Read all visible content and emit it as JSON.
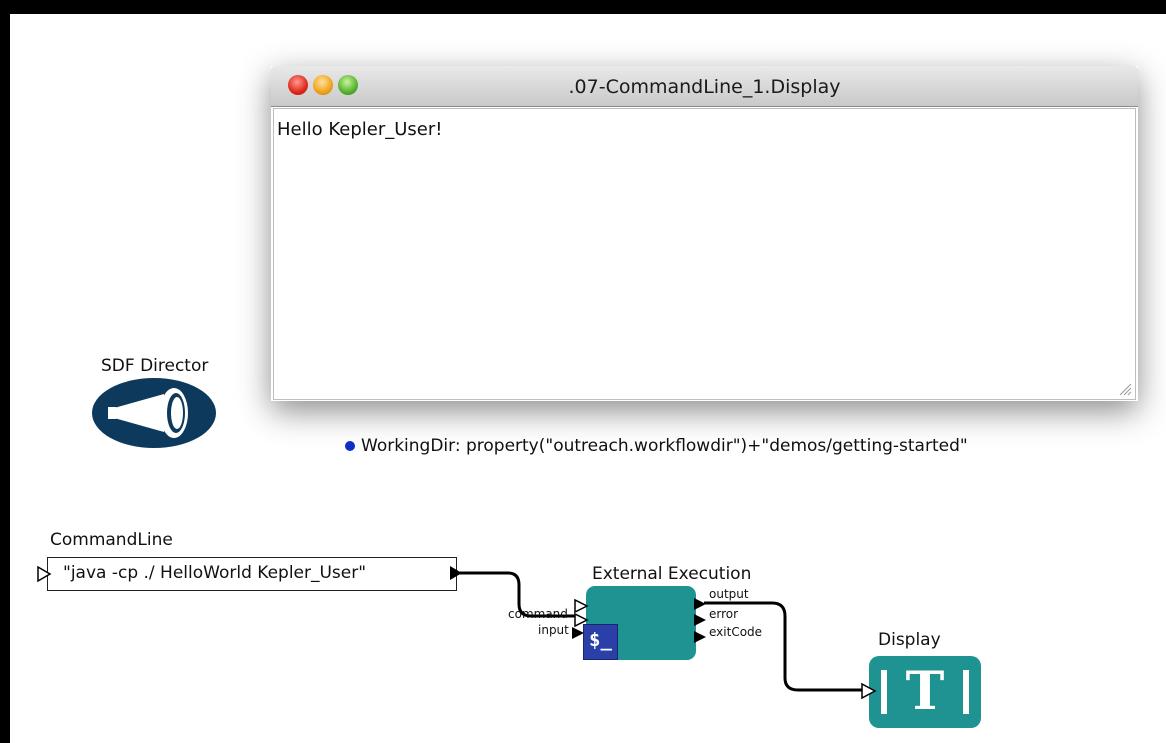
{
  "display_window": {
    "title": ".07-CommandLine_1.Display",
    "content_text": "Hello Kepler_User!"
  },
  "director": {
    "label": "SDF Director"
  },
  "parameter": {
    "text": "WorkingDir: property(\"outreach.workflowdir\")+\"demos/getting-started\""
  },
  "command_line_actor": {
    "label": "CommandLine",
    "value": "\"java -cp ./ HelloWorld Kepler_User\""
  },
  "external_execution_actor": {
    "label": "External Execution",
    "icon_text": "$_",
    "input_ports": [
      "command",
      "input"
    ],
    "output_ports": [
      "output",
      "error",
      "exitCode"
    ]
  },
  "display_actor": {
    "label": "Display",
    "icon_text": "T"
  },
  "colors": {
    "actor_teal": "#1f9392",
    "director_navy": "#0d3a5c",
    "icon_blue": "#2b3fa8",
    "param_dot": "#0b2fc7"
  }
}
